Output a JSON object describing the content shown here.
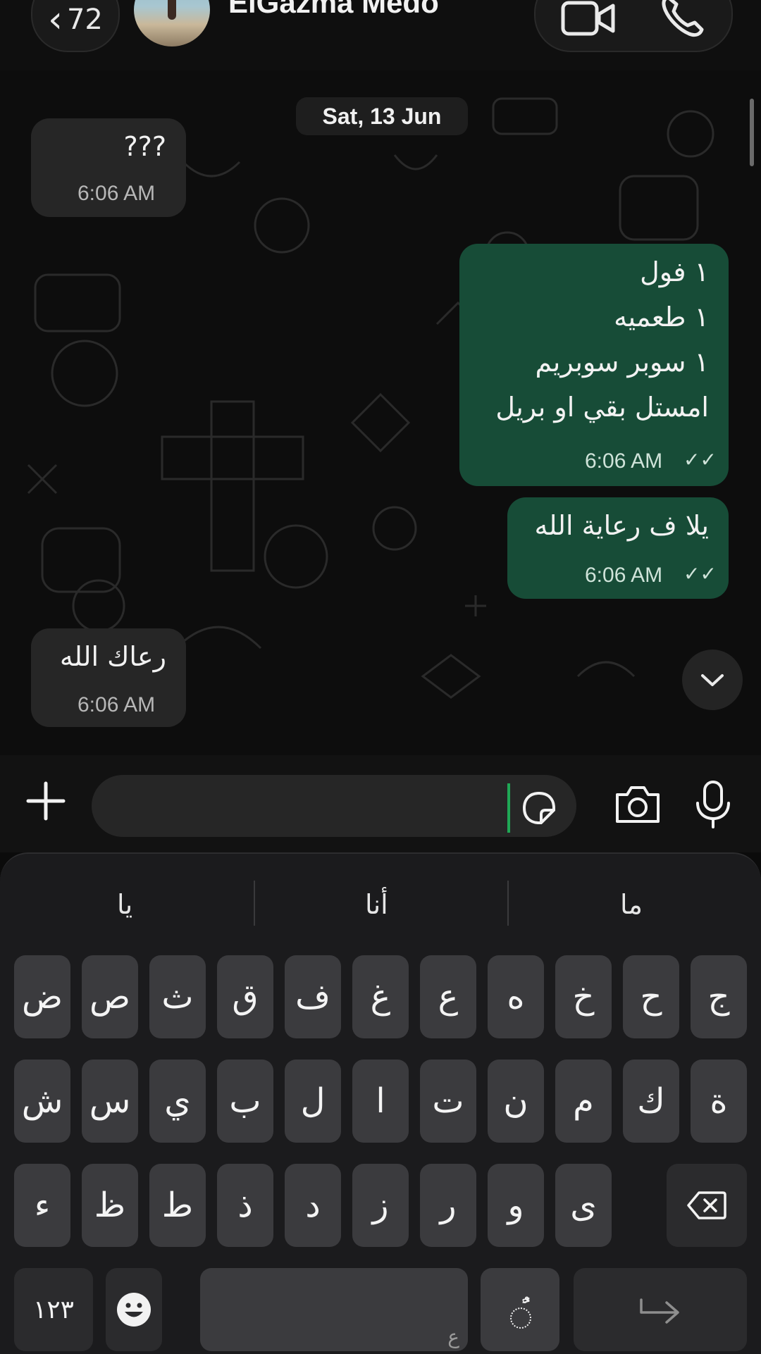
{
  "header": {
    "back_count": "72",
    "contact_name": "ElGazma Medo"
  },
  "chat": {
    "date_chip": "Sat, 13 Jun",
    "messages": [
      {
        "direction": "in",
        "lines": [
          "???"
        ],
        "time": "6:06 AM"
      },
      {
        "direction": "out",
        "lines": [
          "١ فول",
          "١ طعميه",
          "١ سوبر سوبريم",
          "امستل بقي او بريل"
        ],
        "time": "6:06 AM",
        "status": "read"
      },
      {
        "direction": "out",
        "lines": [
          "يلا ف رعاية الله"
        ],
        "time": "6:06 AM",
        "status": "read"
      },
      {
        "direction": "in",
        "lines": [
          "رعاك الله"
        ],
        "time": "6:06 AM"
      }
    ]
  },
  "composer": {
    "value": "",
    "placeholder": ""
  },
  "keyboard": {
    "suggestions": [
      "يا",
      "أنا",
      "ما"
    ],
    "row1": [
      "ج",
      "ح",
      "خ",
      "ه",
      "ع",
      "غ",
      "ف",
      "ق",
      "ث",
      "ص",
      "ض"
    ],
    "row2": [
      "ة",
      "ك",
      "م",
      "ن",
      "ت",
      "ا",
      "ل",
      "ب",
      "ي",
      "س",
      "ش"
    ],
    "row3": [
      "ى",
      "و",
      "ر",
      "ز",
      "د",
      "ذ",
      "ط",
      "ظ",
      "ء"
    ],
    "numbers_key": "١٢٣",
    "space_hint": "ع",
    "tashkeel_key": "ًٌ"
  },
  "colors": {
    "outgoing_bubble": "#174c37",
    "incoming_bubble": "#262626",
    "cursor": "#1fa855"
  }
}
